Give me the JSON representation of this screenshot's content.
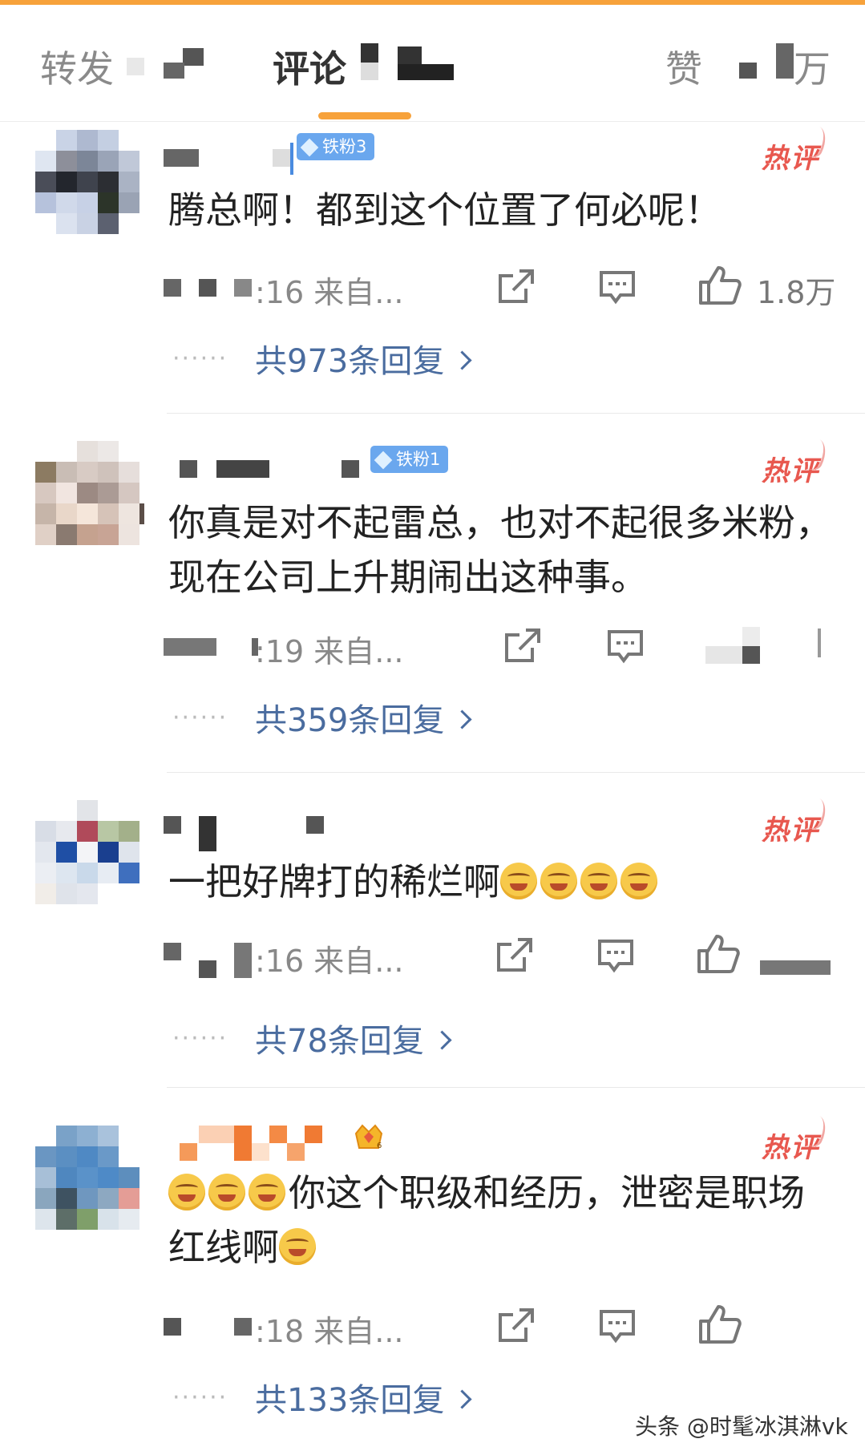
{
  "theme": {
    "accent": "#f7a23b",
    "badge_blue": "#6aa7ee",
    "hot_red": "#e8584f",
    "link_blue": "#4a6c9f"
  },
  "tabs": [
    {
      "label": "转发",
      "active": false
    },
    {
      "label": "评论",
      "active": true
    },
    {
      "label": "赞",
      "active": false
    },
    {
      "label": "万",
      "active": false
    }
  ],
  "comments": [
    {
      "badge": "铁粉3",
      "hot_label": "热评",
      "text": "腾总啊！都到这个位置了何必呢！",
      "time": ":16 来自...",
      "likes": "1.8万",
      "replies": "共973条回复",
      "dots": "······"
    },
    {
      "badge": "铁粉1",
      "hot_label": "热评",
      "text": "你真是对不起雷总，也对不起很多米粉，现在公司上升期闹出这种事。",
      "time": ":19 来自...",
      "likes": "",
      "replies": "共359条回复",
      "dots": "······"
    },
    {
      "hot_label": "热评",
      "text": "一把好牌打的稀烂啊",
      "time": ":16 来自...",
      "likes": "",
      "replies": "共78条回复",
      "dots": "······"
    },
    {
      "hot_label": "热评",
      "text": "你这个职级和经历，泄密是职场红线啊",
      "time": ":18 来自...",
      "likes": "",
      "replies": "共133条回复",
      "dots": "······",
      "crown_level": "6"
    }
  ],
  "watermark": "头条 @时髦冰淇淋vk"
}
